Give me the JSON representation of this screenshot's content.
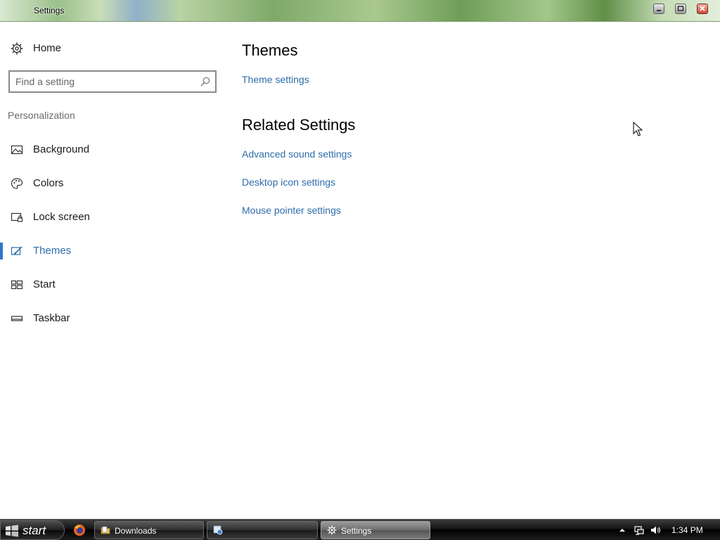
{
  "window": {
    "title": "Settings",
    "buttons": [
      "minimize",
      "maximize",
      "close"
    ]
  },
  "sidebar": {
    "home_label": "Home",
    "search_placeholder": "Find a setting",
    "section_label": "Personalization",
    "items": [
      {
        "label": "Background",
        "icon": "image-icon",
        "active": false
      },
      {
        "label": "Colors",
        "icon": "palette-icon",
        "active": false
      },
      {
        "label": "Lock screen",
        "icon": "lock-screen-icon",
        "active": false
      },
      {
        "label": "Themes",
        "icon": "themes-brush-icon",
        "active": true
      },
      {
        "label": "Start",
        "icon": "start-tiles-icon",
        "active": false
      },
      {
        "label": "Taskbar",
        "icon": "taskbar-icon",
        "active": false
      }
    ]
  },
  "main": {
    "title": "Themes",
    "theme_settings_link": "Theme settings",
    "related_title": "Related Settings",
    "related_links": [
      "Advanced sound settings",
      "Desktop icon settings",
      "Mouse pointer settings"
    ]
  },
  "taskbar": {
    "start_label": "start",
    "tasks": [
      {
        "label": "Downloads",
        "icon": "folder-icon",
        "active": false
      },
      {
        "label": "",
        "icon": "app-icon",
        "active": false
      },
      {
        "label": "Settings",
        "icon": "gear-icon",
        "active": true
      }
    ],
    "clock": "1:34 PM"
  },
  "colors": {
    "accent": "#2e76c7",
    "link": "#2e6dab"
  }
}
